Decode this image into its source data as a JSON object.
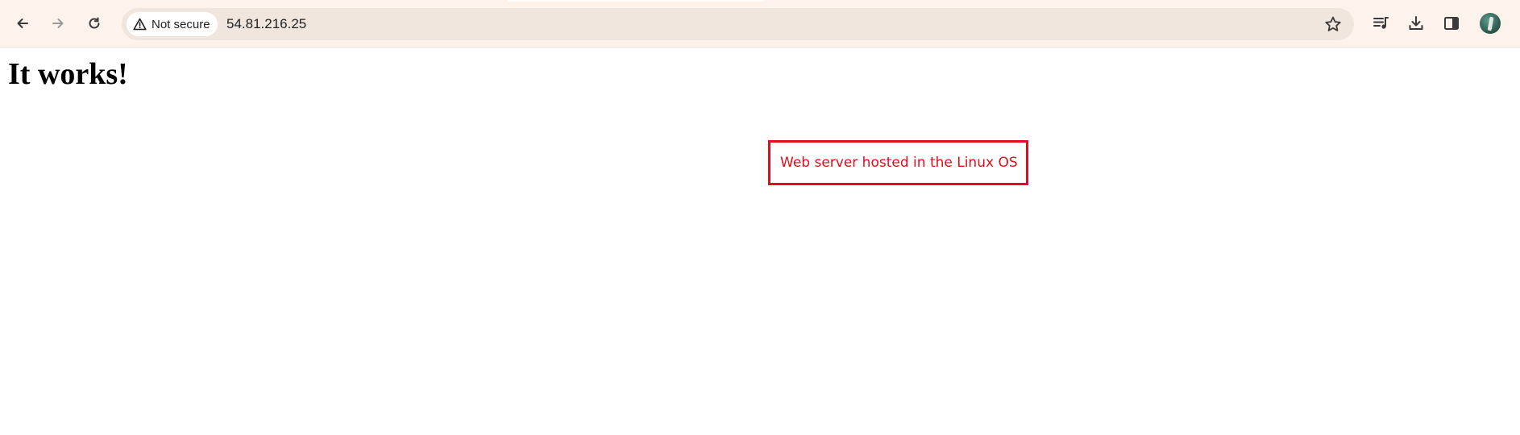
{
  "browser": {
    "address_bar": {
      "security_label": "Not secure",
      "url": "54.81.216.25"
    },
    "toolbar_icons": {
      "back": "arrow-left-icon",
      "forward": "arrow-right-icon",
      "reload": "reload-icon",
      "bookmark": "star-icon",
      "media": "media-playlist-icon",
      "downloads": "download-icon",
      "side_panel": "side-panel-icon",
      "profile": "avatar"
    },
    "colors": {
      "toolbar_bg": "#fdf2ec",
      "omnibox_bg": "#f1e6de"
    }
  },
  "page": {
    "heading": "It works!"
  },
  "annotation": {
    "text": "Web server hosted in the Linux OS",
    "color": "#e00f1a"
  }
}
